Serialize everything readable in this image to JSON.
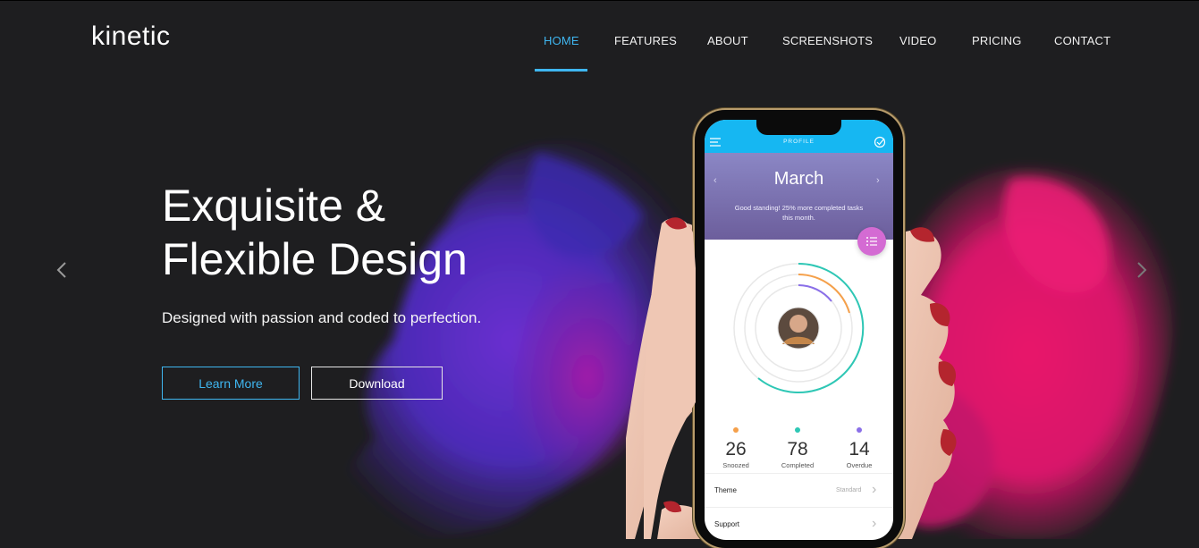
{
  "brand": {
    "name": "kinetic"
  },
  "nav": {
    "items": [
      {
        "label": "HOME",
        "active": true
      },
      {
        "label": "FEATURES"
      },
      {
        "label": "ABOUT"
      },
      {
        "label": "SCREENSHOTS"
      },
      {
        "label": "VIDEO"
      },
      {
        "label": "PRICING"
      },
      {
        "label": "CONTACT"
      }
    ]
  },
  "hero": {
    "title_line1": "Exquisite &",
    "title_line2": "Flexible Design",
    "subtitle": "Designed with passion and coded to perfection.",
    "learn_more": "Learn More",
    "download": "Download"
  },
  "carousel": {
    "prev_icon": "chevron-left-icon",
    "next_icon": "chevron-right-icon"
  },
  "phone": {
    "bar_title": "PROFILE",
    "month": "March",
    "standing": "Good standing! 25% more completed tasks this month.",
    "stats": [
      {
        "value": "26",
        "label": "Snoozed",
        "color": "#f5a04a"
      },
      {
        "value": "78",
        "label": "Completed",
        "color": "#2ec7b5"
      },
      {
        "value": "14",
        "label": "Overdue",
        "color": "#8a6fe8"
      }
    ],
    "rows": [
      {
        "label": "Theme",
        "value": "Standard"
      },
      {
        "label": "Support",
        "value": ""
      }
    ]
  },
  "colors": {
    "accent": "#3fb6f0",
    "background": "#1e1e20"
  }
}
